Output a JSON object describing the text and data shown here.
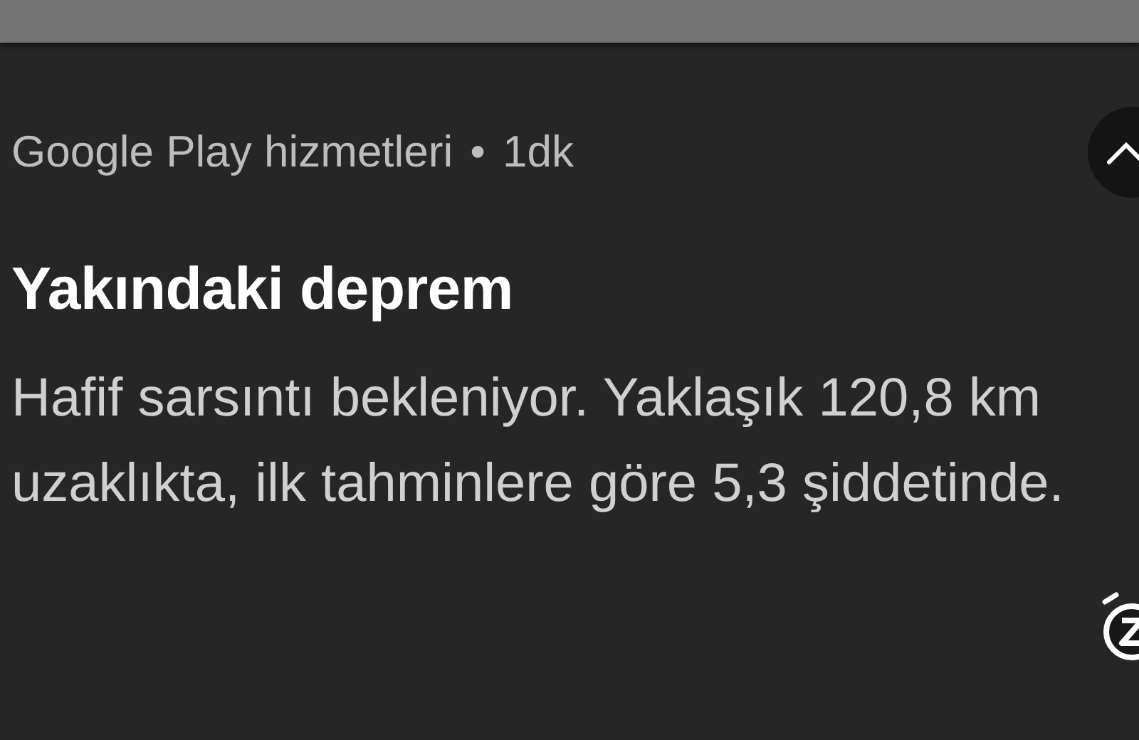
{
  "notification": {
    "app": "Google Play hizmetleri",
    "separator": "•",
    "time": "1dk",
    "expanded": true,
    "title": "Yakındaki deprem",
    "body": "Hafif sarsıntı bekleniyor. Yaklaşık 120,8 km uzaklıkta, ilk tahminlere göre 5,3 şiddetinde."
  }
}
